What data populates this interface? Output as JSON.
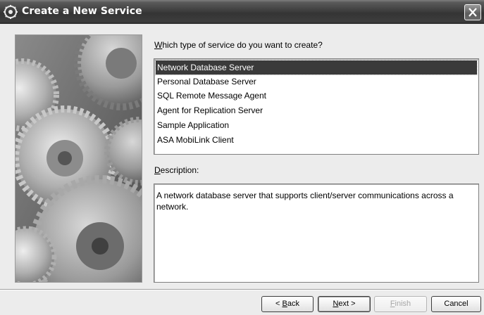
{
  "window": {
    "title": "Create a New Service",
    "title_icon": "gear-wizard-icon",
    "close_icon": "close-icon"
  },
  "main": {
    "prompt_label": "Which type of service do you want to create?",
    "prompt_mnemonic": "W",
    "prompt_rest": "hich type of service do you want to create?",
    "services": [
      {
        "label": "Network Database Server",
        "selected": true
      },
      {
        "label": "Personal Database Server",
        "selected": false
      },
      {
        "label": "SQL Remote Message Agent",
        "selected": false
      },
      {
        "label": "Agent for Replication Server",
        "selected": false
      },
      {
        "label": "Sample Application",
        "selected": false
      },
      {
        "label": "ASA MobiLink Client",
        "selected": false
      }
    ],
    "description_label": "Description:",
    "description_mnemonic": "D",
    "description_rest": "escription:",
    "description_text": "A network database server that supports client/server communications across a network."
  },
  "buttons": {
    "back": "< Back",
    "back_pre": "< ",
    "back_mnemonic": "B",
    "back_rest": "ack",
    "next": "Next >",
    "next_mnemonic": "N",
    "next_rest": "ext >",
    "finish": "Finish",
    "finish_mnemonic": "F",
    "finish_rest": "inish",
    "cancel": "Cancel",
    "finish_enabled": false
  },
  "colors": {
    "title_bar": "#3e3e3e",
    "selection": "#3a3a3a",
    "window_bg": "#ececec"
  }
}
